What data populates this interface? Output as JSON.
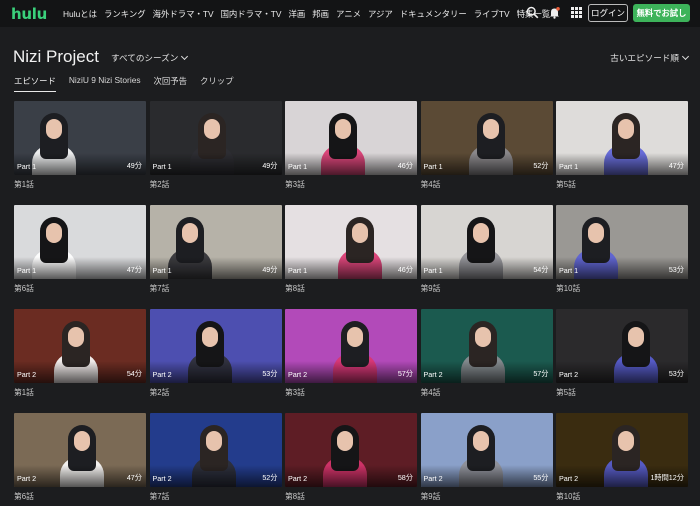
{
  "brand": {
    "logo": "hulu",
    "accent": "#3ad17b"
  },
  "nav": [
    "Huluとは",
    "ランキング",
    "海外ドラマ・TV",
    "国内ドラマ・TV",
    "洋画",
    "邦画",
    "アニメ",
    "アジア",
    "ドキュメンタリー",
    "ライブTV",
    "特集一覧"
  ],
  "header_icons": [
    "search-icon",
    "bell-icon",
    "grid-menu-icon"
  ],
  "login_label": "ログイン",
  "trial_label": "無料でお試し",
  "page_title": "Nizi Project",
  "season_selector": "すべてのシーズン",
  "sort_selector": "古いエピソード順",
  "tabs": [
    "エピソード",
    "NiziU 9 Nizi Stories",
    "次回予告",
    "クリップ"
  ],
  "active_tab": "エピソード",
  "episodes": [
    {
      "part": "Part 1",
      "duration": "49分",
      "label": "第1話",
      "bg": "#3a3f47"
    },
    {
      "part": "Part 1",
      "duration": "49分",
      "label": "第2話",
      "bg": "#2a2b2e"
    },
    {
      "part": "Part 1",
      "duration": "46分",
      "label": "第3話",
      "bg": "#d8d4d6"
    },
    {
      "part": "Part 1",
      "duration": "52分",
      "label": "第4話",
      "bg": "#5b4a35"
    },
    {
      "part": "Part 1",
      "duration": "47分",
      "label": "第5話",
      "bg": "#dedcda"
    },
    {
      "part": "Part 1",
      "duration": "47分",
      "label": "第6話",
      "bg": "#d9dadc"
    },
    {
      "part": "Part 1",
      "duration": "49分",
      "label": "第7話",
      "bg": "#b6b2a8"
    },
    {
      "part": "Part 1",
      "duration": "46分",
      "label": "第8話",
      "bg": "#e5e0e2"
    },
    {
      "part": "Part 1",
      "duration": "54分",
      "label": "第9話",
      "bg": "#d7d5d2"
    },
    {
      "part": "Part 1",
      "duration": "53分",
      "label": "第10話",
      "bg": "#9a9894"
    },
    {
      "part": "Part 2",
      "duration": "54分",
      "label": "第1話",
      "bg": "#6b2c22"
    },
    {
      "part": "Part 2",
      "duration": "53分",
      "label": "第2話",
      "bg": "#4d4fb0"
    },
    {
      "part": "Part 2",
      "duration": "57分",
      "label": "第3話",
      "bg": "#b24ab9"
    },
    {
      "part": "Part 2",
      "duration": "57分",
      "label": "第4話",
      "bg": "#1b5a4f"
    },
    {
      "part": "Part 2",
      "duration": "53分",
      "label": "第5話",
      "bg": "#2b2a2c"
    },
    {
      "part": "Part 2",
      "duration": "47分",
      "label": "第6話",
      "bg": "#7b6a55"
    },
    {
      "part": "Part 2",
      "duration": "52分",
      "label": "第7話",
      "bg": "#233c8c"
    },
    {
      "part": "Part 2",
      "duration": "58分",
      "label": "第8話",
      "bg": "#5e1d25"
    },
    {
      "part": "Part 2",
      "duration": "55分",
      "label": "第9話",
      "bg": "#8aa0c9"
    },
    {
      "part": "Part 2",
      "duration": "1時間12分",
      "label": "第10話",
      "bg": "#3a2c10"
    }
  ]
}
